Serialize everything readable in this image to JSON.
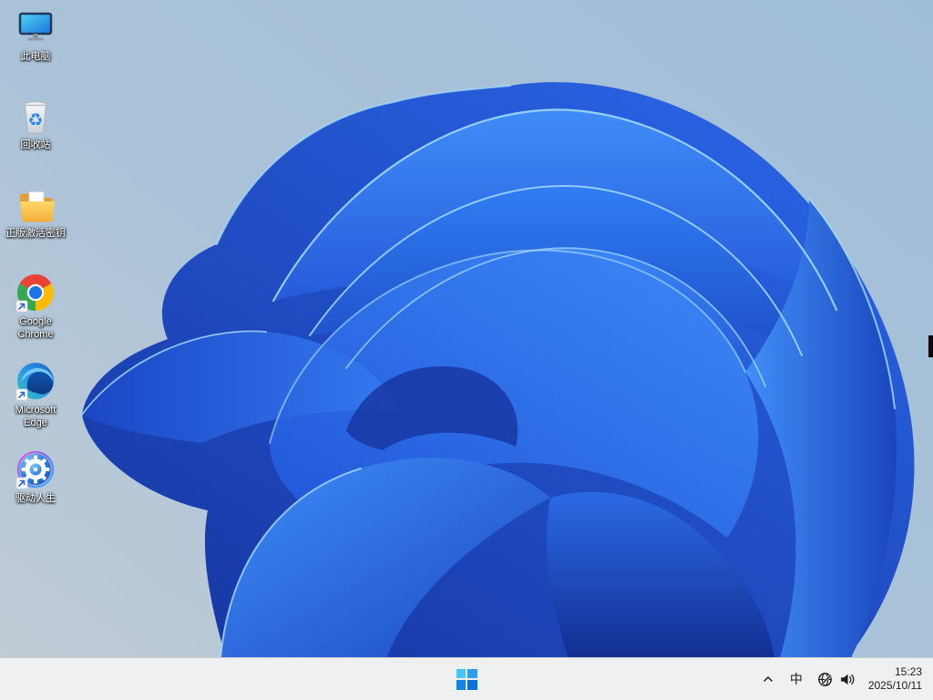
{
  "desktop": {
    "icons": [
      {
        "label": "此电脑",
        "icon": "this-pc-icon",
        "shortcut": false
      },
      {
        "label": "回收站",
        "icon": "recycle-bin-icon",
        "shortcut": false
      },
      {
        "label": "正版激活密钥",
        "icon": "folder-icon",
        "shortcut": false
      },
      {
        "label": "Google Chrome",
        "icon": "chrome-icon",
        "shortcut": true
      },
      {
        "label": "Microsoft Edge",
        "icon": "edge-icon",
        "shortcut": true
      },
      {
        "label": "驱动人生",
        "icon": "driver-life-gear-icon",
        "shortcut": true
      }
    ]
  },
  "taskbar": {
    "start": {
      "icon": "windows-logo-icon"
    },
    "tray": {
      "chevron": {
        "icon": "chevron-up-icon"
      },
      "ime": {
        "label": "中"
      },
      "network": {
        "icon": "globe-no-internet-icon"
      },
      "volume": {
        "icon": "speaker-icon"
      },
      "clock": {
        "time": "15:23",
        "date": "2025/10/11"
      }
    }
  },
  "colors": {
    "taskbar_bg": "#eef0f1",
    "taskbar_border": "#c7c9ca",
    "sky_top_right": "#a1bed9",
    "sky_bottom_left": "#c0cbd5",
    "bloom_deep": "#16339e",
    "bloom_primary": "#2b6df0",
    "bloom_bright": "#3f8cf8",
    "bloom_edge_highlight": "#a8def7",
    "tray_text": "#1c1c1c",
    "icon_label_text": "#ffffff"
  }
}
